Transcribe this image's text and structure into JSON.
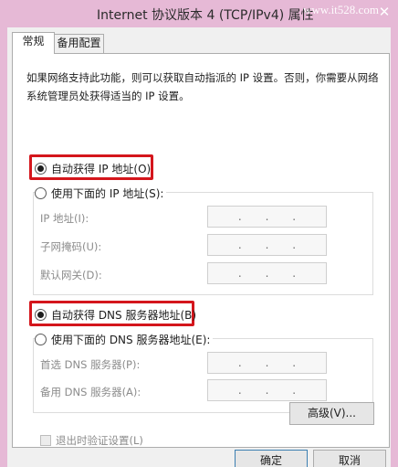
{
  "window": {
    "title": "Internet 协议版本 4 (TCP/IPv4) 属性",
    "watermark": "www.it528.com",
    "close_glyph": "✕"
  },
  "tabs": [
    {
      "label": "常规",
      "active": true
    },
    {
      "label": "备用配置",
      "active": false
    }
  ],
  "description": "如果网络支持此功能，则可以获取自动指派的 IP 设置。否则，你需要从网络系统管理员处获得适当的 IP 设置。",
  "ip_section": {
    "auto_label": "自动获得 IP 地址(O)",
    "auto_selected": true,
    "manual_label": "使用下面的 IP 地址(S):",
    "manual_selected": false,
    "fields": [
      {
        "label": "IP 地址(I):",
        "value": ".   .   ."
      },
      {
        "label": "子网掩码(U):",
        "value": ".   .   ."
      },
      {
        "label": "默认网关(D):",
        "value": ".   .   ."
      }
    ]
  },
  "dns_section": {
    "auto_label": "自动获得 DNS 服务器地址(B)",
    "auto_selected": true,
    "manual_label": "使用下面的 DNS 服务器地址(E):",
    "manual_selected": false,
    "fields": [
      {
        "label": "首选 DNS 服务器(P):",
        "value": ".   .   ."
      },
      {
        "label": "备用 DNS 服务器(A):",
        "value": ".   .   ."
      }
    ]
  },
  "validate_on_exit": {
    "label": "退出时验证设置(L)",
    "checked": false,
    "enabled": false
  },
  "buttons": {
    "advanced": "高级(V)...",
    "ok": "确定",
    "cancel": "取消"
  },
  "highlight_color": "#d4161c"
}
